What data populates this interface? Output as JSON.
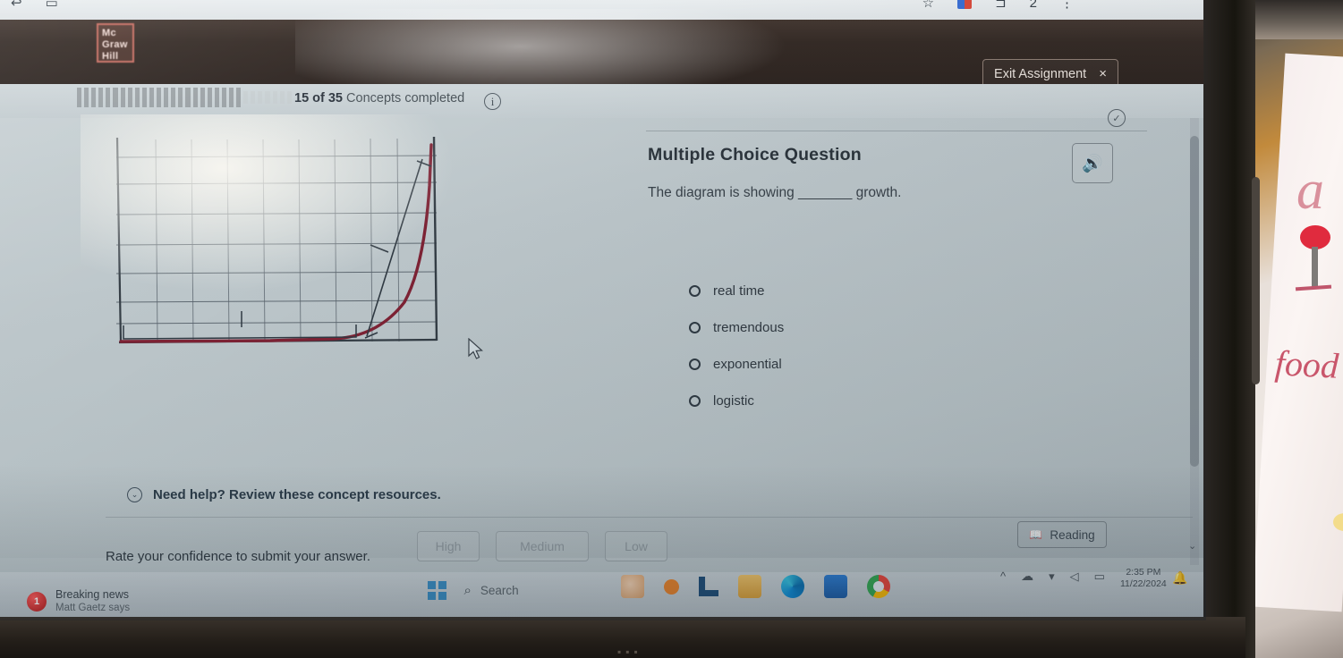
{
  "browser": {
    "icons_left": [
      "back-arrow-icon",
      "tab-icon"
    ],
    "icons_right": [
      "bookmark-icon",
      "extensions-icon",
      "profile-icon",
      "menu-icon"
    ]
  },
  "header": {
    "logo_line1": "Mc",
    "logo_line2": "Graw",
    "logo_line3": "Hill",
    "exit_label": "Exit Assignment",
    "exit_close": "×"
  },
  "progress": {
    "completed": 15,
    "total": 35,
    "text_prefix": "15 of 35",
    "text_suffix": "Concepts completed",
    "info_glyph": "i",
    "timer_glyph": "✓",
    "segments_done": 23,
    "segments_total": 30
  },
  "question": {
    "title": "Multiple Choice Question",
    "stem": "The diagram is showing _______ growth.",
    "audio_glyph": "🔊",
    "options": [
      {
        "label": "real time",
        "selected": false
      },
      {
        "label": "tremendous",
        "selected": false
      },
      {
        "label": "exponential",
        "selected": false
      },
      {
        "label": "logistic",
        "selected": false
      }
    ]
  },
  "chart_data": {
    "type": "line",
    "title": "",
    "xlabel": "",
    "ylabel": "",
    "grid": true,
    "legend": null,
    "xlim": [
      0,
      10
    ],
    "ylim": [
      0,
      7
    ],
    "x": [
      0,
      1,
      2,
      3,
      4,
      5,
      6,
      6.5,
      7,
      7.5,
      8,
      8.5,
      9,
      9.3,
      9.6,
      9.8
    ],
    "y": [
      0.02,
      0.03,
      0.04,
      0.05,
      0.07,
      0.1,
      0.16,
      0.22,
      0.33,
      0.5,
      0.8,
      1.4,
      2.6,
      3.8,
      5.2,
      6.6
    ],
    "series_color": "#7d2234",
    "annotations": [
      {
        "name": "tangent-line",
        "description": "hand-drawn straight line rising steeply near right edge"
      },
      {
        "name": "lag-phase-bracket",
        "description": "bracket under the flat portion of the curve"
      },
      {
        "name": "tick-mark",
        "description": "small vertical tick on the lower grid"
      }
    ],
    "x_gridlines": 9,
    "y_gridlines": 7
  },
  "footer": {
    "help_text": "Need help? Review these concept resources.",
    "help_chevron": "⌄",
    "confidence_prompt": "Rate your confidence to submit your answer.",
    "confidence_buttons": [
      "High",
      "Medium",
      "Low"
    ],
    "reading_label": "Reading",
    "reading_icon": "📖",
    "caret": "⌄"
  },
  "taskbar": {
    "news_badge": "1",
    "news_title": "Breaking news",
    "news_sub": "Matt Gaetz says",
    "search_label": "Search",
    "start_icon": "windows-logo-icon",
    "apps": [
      "weather-icon",
      "pumpkin-icon",
      "lseat-icon",
      "folder-icon",
      "edge-icon",
      "store-icon",
      "chrome-icon"
    ],
    "tray_icons": [
      "chevron-up-icon",
      "onedrive-icon",
      "wifi-icon",
      "volume-icon",
      "battery-icon"
    ],
    "time": "2:35 PM",
    "date": "11/22/2024",
    "bell_icon": "🔔"
  },
  "desk": {
    "paper_marks": [
      "a",
      "lollipop-drawing",
      "food"
    ]
  },
  "colors": {
    "accent_curve": "#7d2234",
    "header_dark": "#2e2521",
    "page_bg": "#bcc6ca",
    "text_primary": "#2c353c"
  }
}
